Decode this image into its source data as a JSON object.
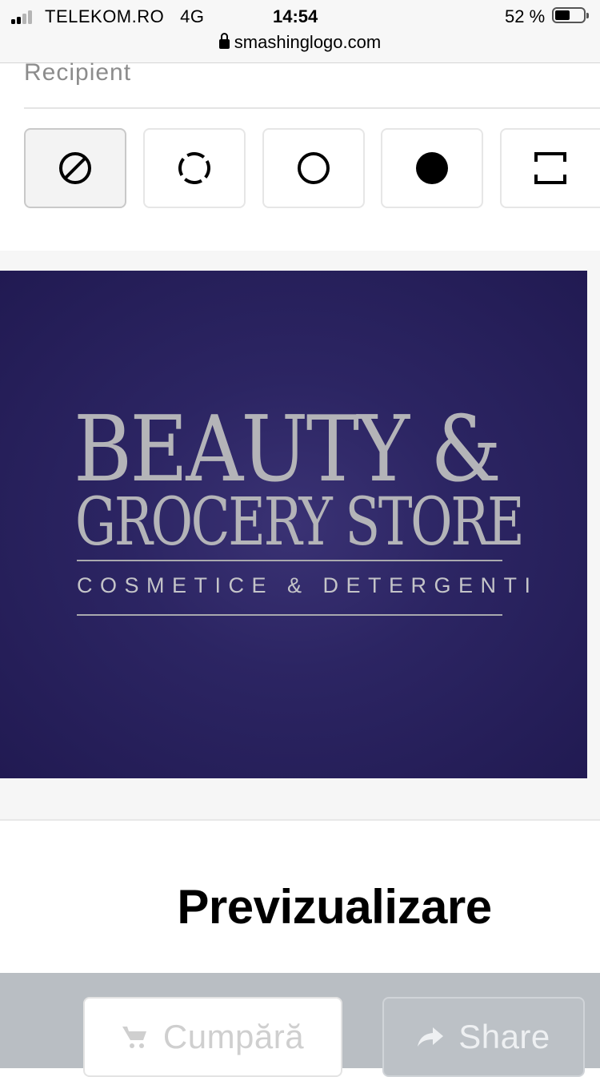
{
  "status_bar": {
    "carrier": "TELEKOM.RO",
    "network": "4G",
    "time": "14:54",
    "battery_percent_text": "52 %",
    "battery_level": 0.52,
    "signal_bars_active": 2,
    "url": "smashinglogo.com"
  },
  "recipient": {
    "label": "Recipient",
    "shape_options": [
      {
        "icon": "none-slash-icon",
        "selected": true
      },
      {
        "icon": "dashed-circle-icon",
        "selected": false
      },
      {
        "icon": "circle-outline-icon",
        "selected": false
      },
      {
        "icon": "filled-circle-icon",
        "selected": false
      },
      {
        "icon": "square-brackets-icon",
        "selected": false
      }
    ]
  },
  "logo": {
    "line1": "BEAUTY &",
    "line2": "GROCERY STORE",
    "tagline": "COSMETICE & DETERGENTI",
    "background": "#2c2563",
    "text_color": "#b4b4b8"
  },
  "preview": {
    "title": "Previzualizare"
  },
  "actions": {
    "buy_label": "Cumpără",
    "buy_icon": "cart-icon",
    "share_label": "Share",
    "share_icon": "share-arrow-icon"
  }
}
